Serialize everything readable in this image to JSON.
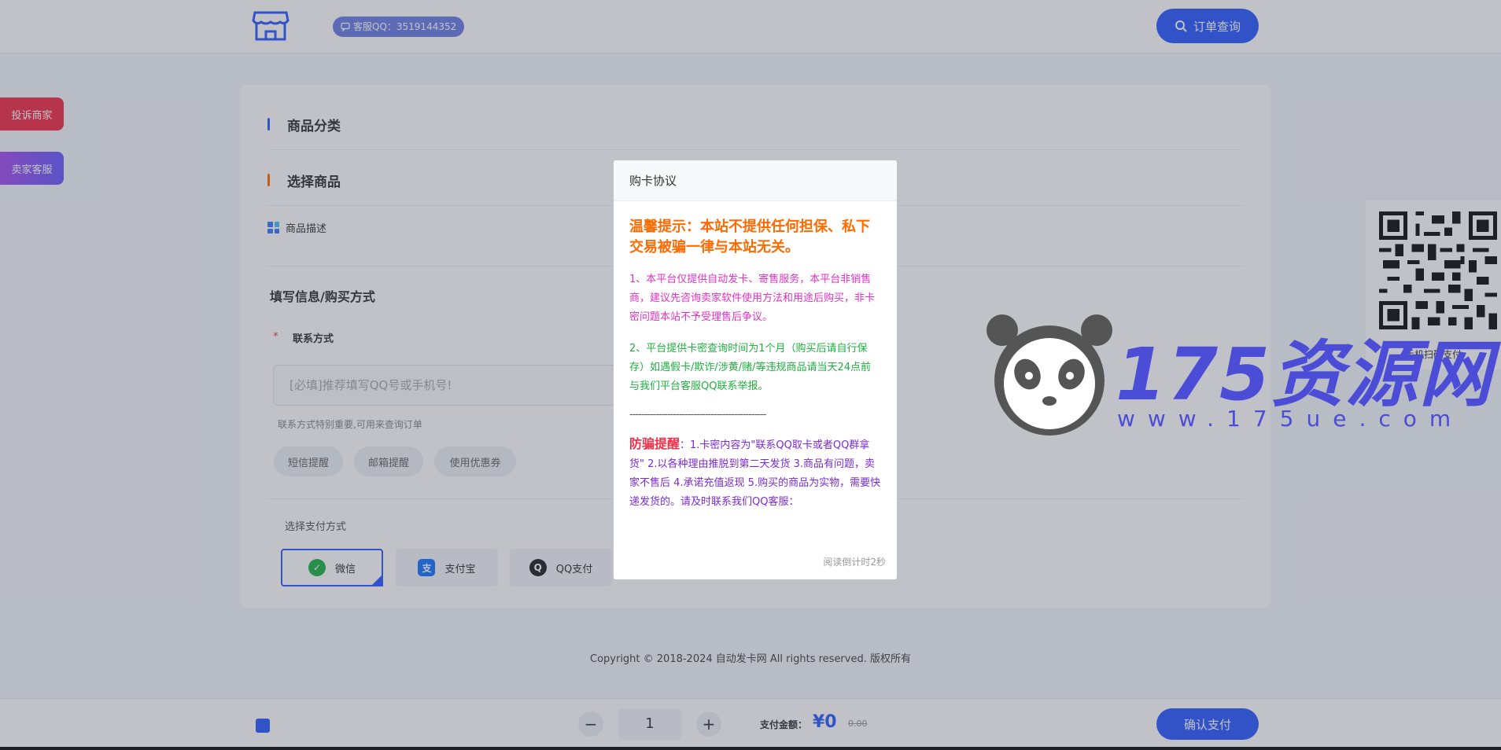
{
  "header": {
    "qq_label": "客服QQ：3519144352",
    "order_query": "订单查询"
  },
  "side": {
    "complaint": "投诉商家",
    "service": "卖家客服"
  },
  "main": {
    "category_title": "商品分类",
    "select_title": "选择商品",
    "desc_label": "商品描述",
    "fill_title": "填写信息/购买方式",
    "required_star": "*",
    "contact_label": "联系方式",
    "contact_placeholder": "[必填]推荐填写QQ号或手机号!",
    "contact_hint": "联系方式特别重要,可用来查询订单",
    "pills": [
      "短信提醒",
      "邮箱提醒",
      "使用优惠券"
    ],
    "pay_title": "选择支付方式",
    "pay_methods": [
      "微信",
      "支付宝",
      "QQ支付"
    ]
  },
  "copyright": "Copyright © 2018-2024 自动发卡网 All rights reserved. 版权所有",
  "footer": {
    "minus": "−",
    "plus": "+",
    "quantity": "1",
    "amount_label": "支付金额：",
    "amount": "¥0",
    "original": "0.00",
    "confirm": "确认支付"
  },
  "qr": {
    "caption": "手机扫码支付"
  },
  "watermark": {
    "title": "175资源网",
    "url": "www.175ue.com"
  },
  "modal": {
    "title": "购卡协议",
    "warning": "温馨提示：本站不提供任何担保、私下交易被骗一律与本站无关。",
    "p1": "1、本平台仅提供自动发卡、寄售服务，本平台非销售商，建议先咨询卖家软件使用方法和用途后购买，非卡密问题本站不予受理售后争议。",
    "p2": "2、平台提供卡密查询时间为1个月（购买后请自行保存）如遇假卡/欺诈/涉黄/赌/等违规商品请当天24点前与我们平台客服QQ联系举报。",
    "dashes": "-----------------------------------------------",
    "fraud_title": "防骗提醒",
    "fraud_text": "：1.卡密内容为\"联系QQ取卡或者QQ群拿货\" 2.以各种理由推脱到第二天发货 3.商品有问题，卖家不售后 4.承诺充值返现 5.购买的商品为实物，需要快递发货的。请及时联系我们QQ客服：",
    "countdown": "阅读倒计时2秒"
  }
}
